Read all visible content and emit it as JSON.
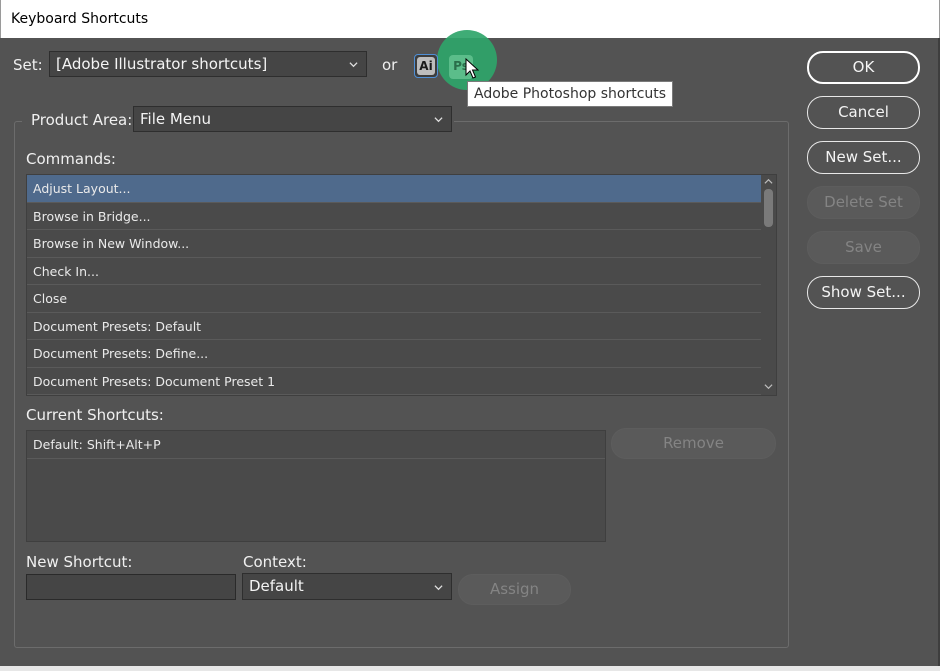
{
  "window": {
    "title": "Keyboard Shortcuts"
  },
  "set": {
    "label": "Set:",
    "value": "[Adobe Illustrator shortcuts]",
    "or_label": "or",
    "ai_icon_text": "Ai",
    "ps_icon_text": "Ps",
    "tooltip": "Adobe Photoshop shortcuts"
  },
  "product_area": {
    "label": "Product Area:",
    "value": "File Menu"
  },
  "commands": {
    "label": "Commands:",
    "items": [
      "Adjust Layout...",
      "Browse in Bridge...",
      "Browse in New Window...",
      "Check In...",
      "Close",
      "Document Presets: Default",
      "Document Presets: Define...",
      "Document Presets: Document Preset 1"
    ],
    "selected_index": 0
  },
  "current_shortcuts": {
    "label": "Current Shortcuts:",
    "items": [
      "Default: Shift+Alt+P"
    ],
    "remove_label": "Remove"
  },
  "new_shortcut": {
    "label": "New Shortcut:",
    "value": ""
  },
  "context": {
    "label": "Context:",
    "value": "Default"
  },
  "assign_label": "Assign",
  "buttons": {
    "ok": "OK",
    "cancel": "Cancel",
    "new_set": "New Set...",
    "delete_set": "Delete Set",
    "save": "Save",
    "show_set": "Show Set..."
  },
  "colors": {
    "background": "#535353",
    "selection": "#4f6a8c",
    "photoshop_highlight": "#2fa56a"
  },
  "icons": [
    "chevron-down-icon",
    "illustrator-icon",
    "photoshop-icon",
    "mouse-cursor-icon",
    "scroll-up-icon",
    "scroll-down-icon"
  ]
}
